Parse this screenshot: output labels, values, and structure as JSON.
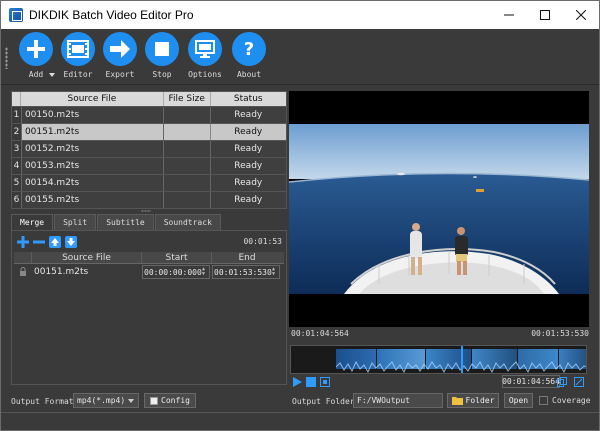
{
  "window": {
    "title": "DIKDIK Batch Video Editor Pro"
  },
  "toolbar": [
    {
      "label": "Add",
      "icon": "plus-icon"
    },
    {
      "label": "Editor",
      "icon": "film-icon"
    },
    {
      "label": "Export",
      "icon": "arrow-right-icon"
    },
    {
      "label": "Stop",
      "icon": "stop-icon"
    },
    {
      "label": "Options",
      "icon": "monitor-icon"
    },
    {
      "label": "About",
      "icon": "question-icon"
    }
  ],
  "file_table": {
    "headers": [
      "Source File",
      "File Size",
      "Status"
    ],
    "rows": [
      {
        "num": "1",
        "source": "00150.m2ts",
        "size": "",
        "status": "Ready"
      },
      {
        "num": "2",
        "source": "00151.m2ts",
        "size": "",
        "status": "Ready"
      },
      {
        "num": "3",
        "source": "00152.m2ts",
        "size": "",
        "status": "Ready"
      },
      {
        "num": "4",
        "source": "00153.m2ts",
        "size": "",
        "status": "Ready"
      },
      {
        "num": "5",
        "source": "00154.m2ts",
        "size": "",
        "status": "Ready"
      },
      {
        "num": "6",
        "source": "00155.m2ts",
        "size": "",
        "status": "Ready"
      }
    ],
    "selected_index": 1
  },
  "tabs": [
    "Merge",
    "Split",
    "Subtitle",
    "Soundtrack"
  ],
  "merge": {
    "duration": "00:01:53",
    "headers": [
      "Source File",
      "Start",
      "End"
    ],
    "rows": [
      {
        "source": "00151.m2ts",
        "start": "00:00:00:000",
        "end": "00:01:53:530"
      }
    ]
  },
  "preview": {
    "time_current": "00:01:04:564",
    "time_total": "00:01:53:530",
    "position_fraction": 0.57
  },
  "playback": {
    "time": "00:01:04:564"
  },
  "bottom": {
    "format_label": "Output Format",
    "format_value": "mp4(*.mp4)",
    "config_label": "Config",
    "folder_label": "Output Folder",
    "folder_value": "F:/VWOutput",
    "folder_button": "Folder",
    "open_button": "Open",
    "coverage_label": "Coverage"
  },
  "colors": {
    "accent": "#1e8ff0",
    "selected_row": "#c8c8c8",
    "background": "#3a3a3a"
  }
}
